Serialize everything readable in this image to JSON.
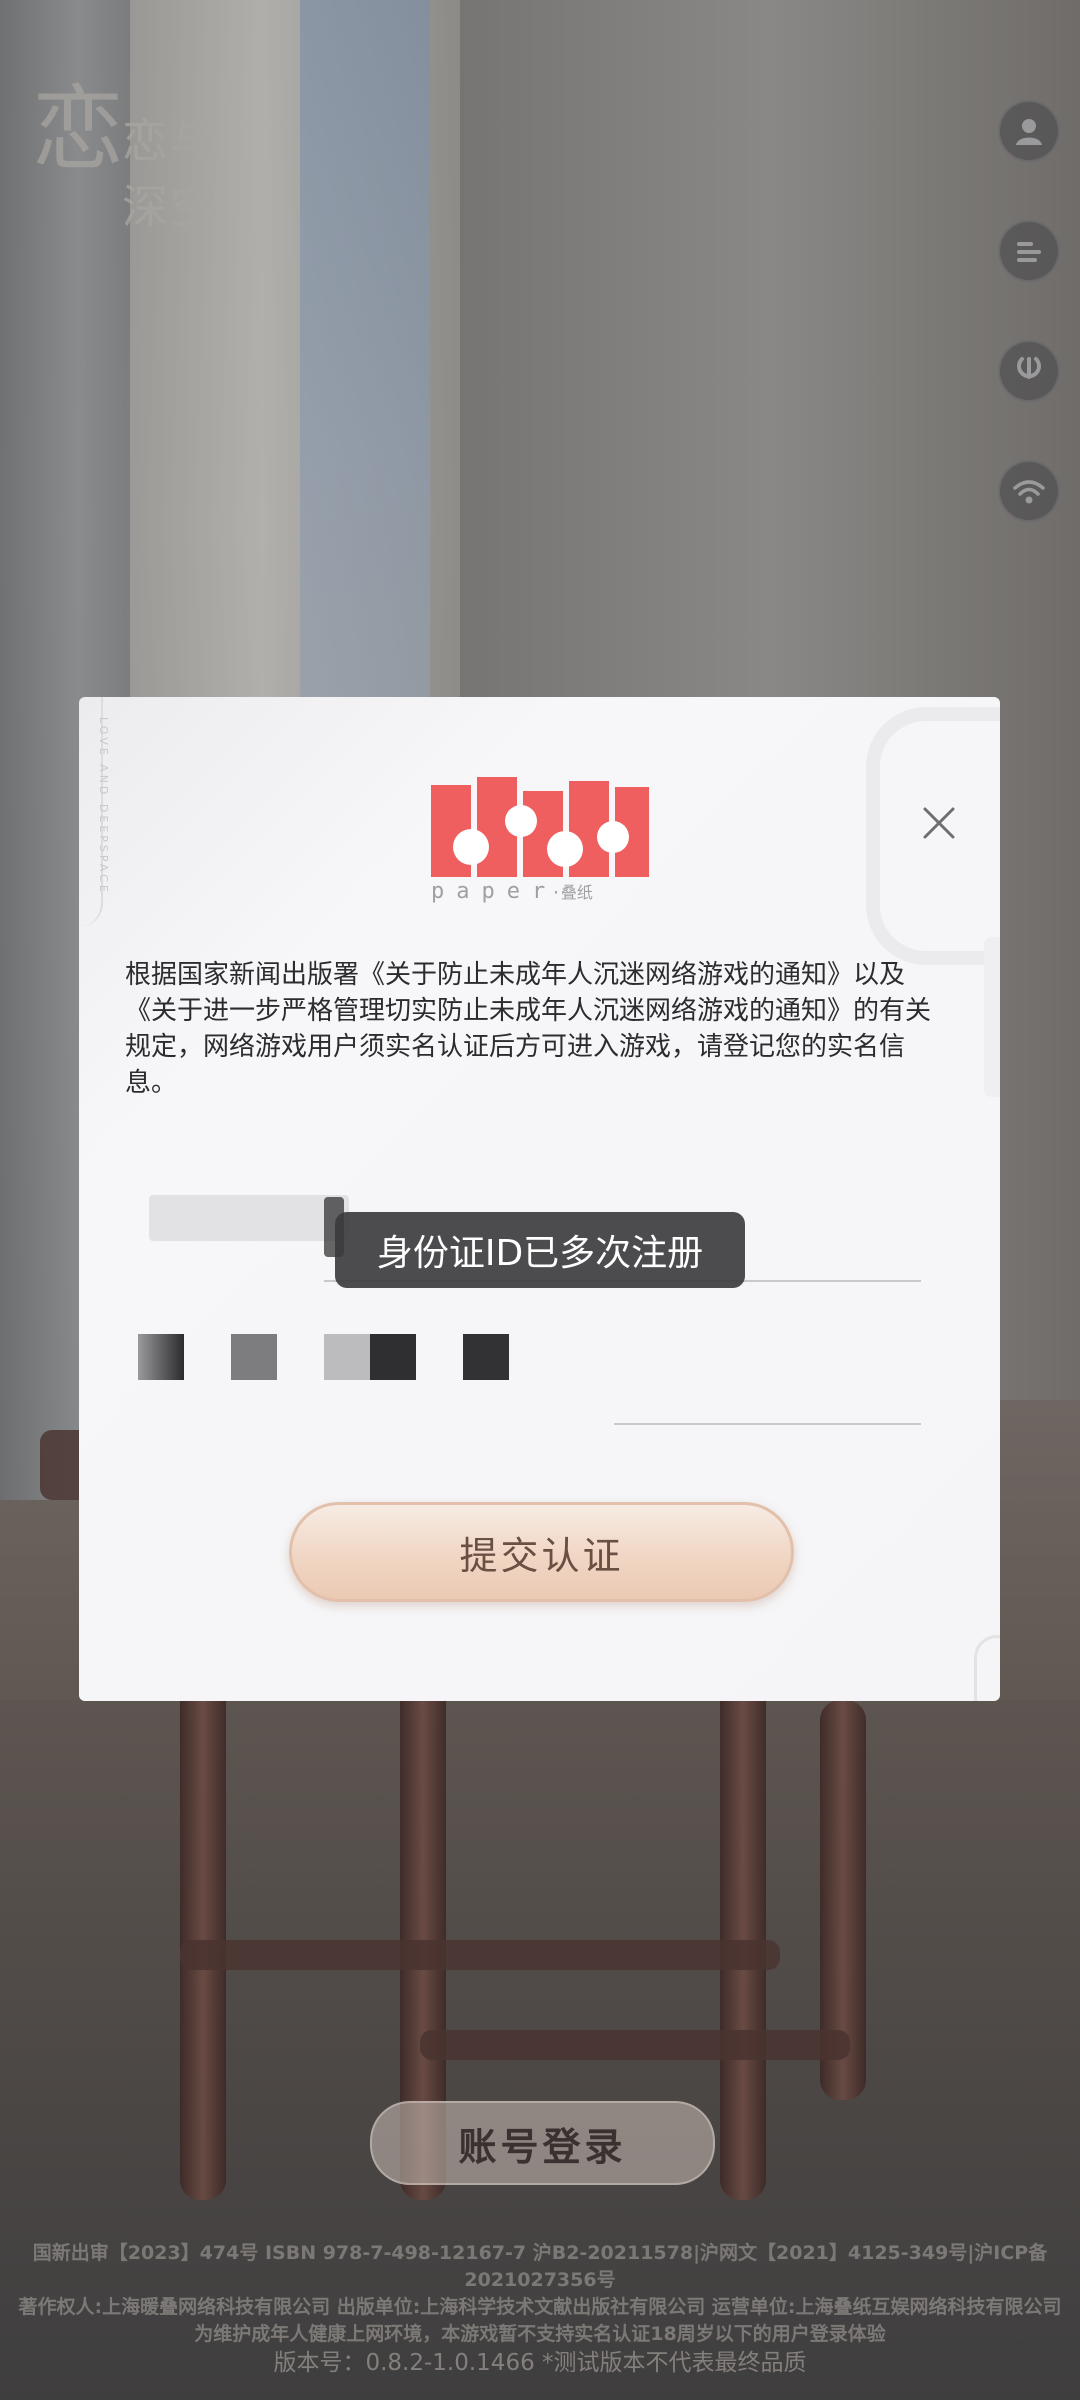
{
  "app": {
    "logo_text": "恋与深空"
  },
  "side_buttons": [
    {
      "name": "account-icon"
    },
    {
      "name": "notice-icon"
    },
    {
      "name": "repair-icon"
    },
    {
      "name": "network-icon"
    }
  ],
  "dialog": {
    "brand_word": "paper",
    "brand_cn": "·叠纸",
    "side_text": "LOVE AND DEEPSPACE",
    "notice_text": "根据国家新闻出版署《关于防止未成年人沉迷网络游戏的通知》以及《关于进一步严格管理切实防止未成年人沉迷网络游戏的通知》的有关规定，网络游戏用户须实名认证后方可进入游戏，请登记您的实名信息。",
    "toast_text": "身份证ID已多次注册",
    "submit_label": "提交认证",
    "colors": {
      "brand_red": "#ef5f5f",
      "submit_text": "#6a4f43"
    }
  },
  "login_button": "账号登录",
  "footer": {
    "line1": "国新出审【2023】474号 ISBN 978-7-498-12167-7 沪B2-20211578|沪网文【2021】4125-349号|沪ICP备2021027356号",
    "line2": "著作权人:上海暖叠网络科技有限公司 出版单位:上海科学技术文献出版社有限公司 运营单位:上海叠纸互娱网络科技有限公司",
    "line3": "为维护成年人健康上网环境，本游戏暂不支持实名认证18周岁以下的用户登录体验",
    "version": "版本号：0.8.2-1.0.1466 *测试版本不代表最终品质"
  }
}
